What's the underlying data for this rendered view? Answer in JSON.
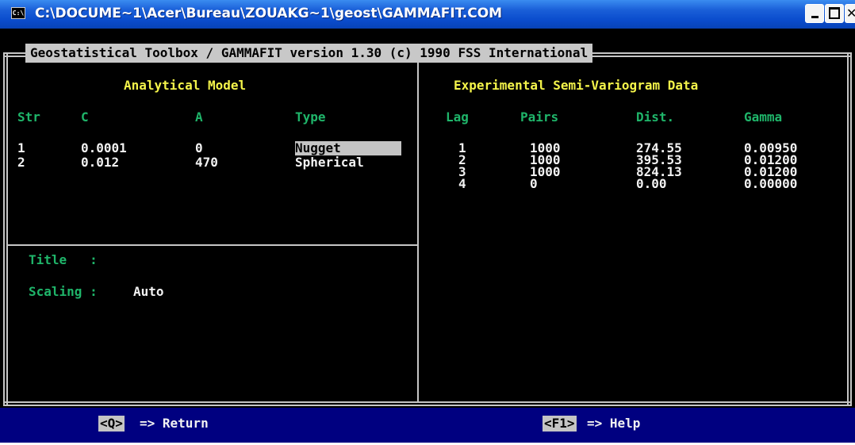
{
  "window": {
    "title": "C:\\DOCUME~1\\Acer\\Bureau\\ZOUAKG~1\\geost\\GAMMAFIT.COM",
    "icon_text": "C:\\",
    "min_icon": "minimize-icon",
    "max_icon": "maximize-icon",
    "close_icon": "close-icon",
    "close_glyph": "✕"
  },
  "header": "Geostatistical Toolbox / GAMMAFIT version 1.30 (c) 1990 FSS International",
  "model": {
    "title": "Analytical Model",
    "columns": [
      "Str",
      "C",
      "A",
      "Type"
    ],
    "rows": [
      {
        "str": "1",
        "c": "0.0001",
        "a": "0",
        "type": "Nugget"
      },
      {
        "str": "2",
        "c": "0.012",
        "a": "470",
        "type": "Spherical"
      }
    ]
  },
  "variogram": {
    "title": "Experimental Semi-Variogram Data",
    "columns": [
      "Lag",
      "Pairs",
      "Dist.",
      "Gamma"
    ],
    "rows": [
      {
        "lag": "1",
        "pairs": "1000",
        "dist": "274.55",
        "gamma": "0.00950"
      },
      {
        "lag": "2",
        "pairs": "1000",
        "dist": "395.53",
        "gamma": "0.01200"
      },
      {
        "lag": "3",
        "pairs": "1000",
        "dist": "824.13",
        "gamma": "0.01200"
      },
      {
        "lag": "4",
        "pairs": "0",
        "dist": "0.00",
        "gamma": "0.00000"
      }
    ]
  },
  "settings": {
    "title_label": "Title   :",
    "title_value": "",
    "scaling_label": "Scaling :",
    "scaling_value": "Auto"
  },
  "status": {
    "return_key": "<Q>",
    "return_label": "=> Return",
    "help_key": "<F1>",
    "help_label": "=> Help"
  }
}
